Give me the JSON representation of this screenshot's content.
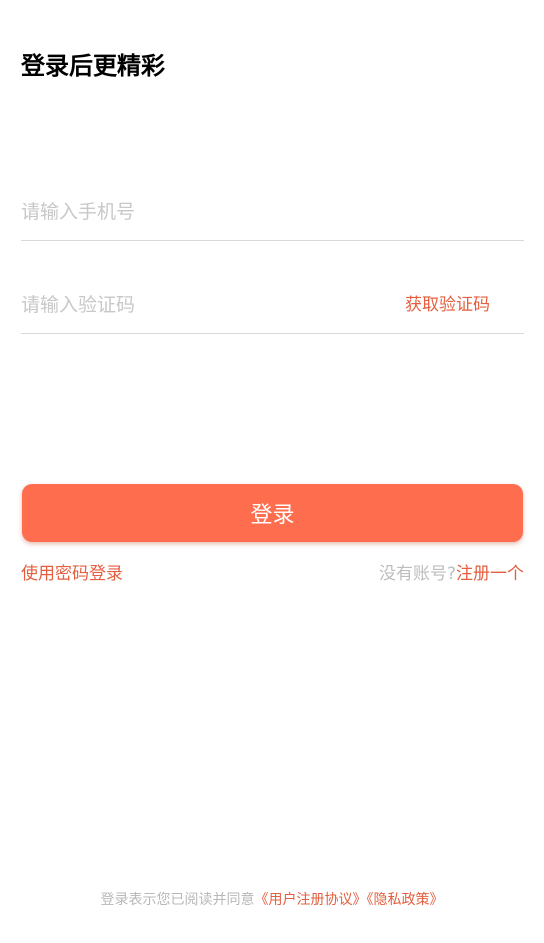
{
  "header": {
    "title": "登录后更精彩"
  },
  "form": {
    "phone_placeholder": "请输入手机号",
    "code_placeholder": "请输入验证码",
    "get_code_label": "获取验证码",
    "login_label": "登录"
  },
  "links": {
    "password_login": "使用密码登录",
    "no_account": "没有账号?",
    "register": "注册一个"
  },
  "footer": {
    "agreement_prefix": "登录表示您已阅读并同意",
    "user_agreement": "《用户注册协议》",
    "privacy_policy": "《隐私政策》"
  },
  "colors": {
    "accent": "#ff6d4f",
    "link": "#e35f3f",
    "placeholder": "#c8c8c8",
    "divider": "#d9d9d9"
  }
}
